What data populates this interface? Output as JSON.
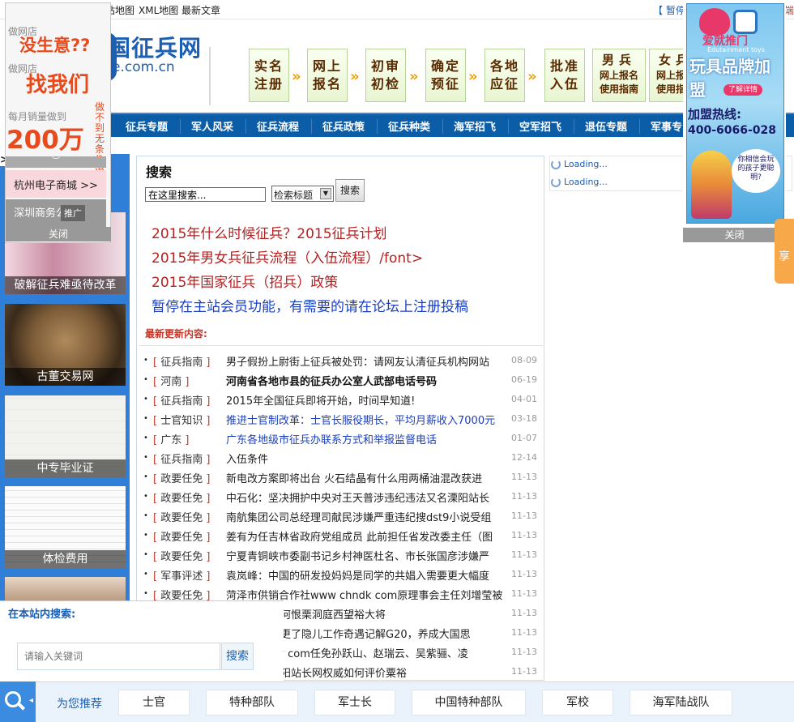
{
  "topbar": {
    "left_items": [
      "站地图",
      "XML地图",
      "最新文章"
    ],
    "right_text": "【  暂停",
    "right_tail": "端"
  },
  "header": {
    "logo_main": "国征兵网",
    "logo_sub": "e.com.cn"
  },
  "flow_steps": [
    {
      "label": "实名注册"
    },
    {
      "label": "网上报名"
    },
    {
      "label": "初审初检"
    },
    {
      "label": "确定预征"
    },
    {
      "label": "各地应征"
    },
    {
      "label": "批准入伍"
    }
  ],
  "guide_buttons": [
    {
      "big": "男兵",
      "line1": "网上报名",
      "line2": "使用指南"
    },
    {
      "big": "女兵",
      "line1": "网上报名",
      "line2": "使用指南"
    }
  ],
  "nav": {
    "items": [
      "征兵专题",
      "军人风采",
      "征兵流程",
      "征兵政策",
      "征兵种类",
      "海军招飞",
      "空军招飞",
      "退伍专题",
      "军事专"
    ]
  },
  "left_ad": {
    "line1": "做网店",
    "line2": "没生意??",
    "line3": "做网店",
    "line4": "找我们",
    "line5": "每月销量做到",
    "line6": "200万",
    "vertical": "做不到无条件退款",
    "slider_glyph": "︶",
    "link1": "杭州电子商城 >>",
    "link2": "深圳商务公司",
    "promo": "推广",
    "close": "关闭"
  },
  "left_arrows": ">>",
  "left_thumbs": [
    {
      "caption": "破解征兵难亟待改革"
    },
    {
      "caption": "古董交易网"
    },
    {
      "caption": "中专毕业证"
    },
    {
      "caption": "体检费用"
    }
  ],
  "search": {
    "title": "搜索",
    "input_value": "在这里搜索...",
    "select_value": "检索标题",
    "button": "搜索"
  },
  "headlines": [
    {
      "text": "2015年什么时候征兵？2015征兵计划",
      "color": "#b22222"
    },
    {
      "text": "2015年男女兵征兵流程（入伍流程）/font>",
      "color": "#b22222"
    },
    {
      "text": "2015年国家征兵（招兵）政策",
      "color": "#b22222"
    },
    {
      "text": "暂停在主站会员功能，有需要的请在论坛上注册投稿",
      "color": "#1a3fbf"
    }
  ],
  "latest": {
    "heading": "最新更新内容:",
    "rows": [
      {
        "cat": "征兵指南",
        "title": "男子假扮上尉街上征兵被处罚：请网友认清征兵机构网站",
        "date": "08-09",
        "style": "normal"
      },
      {
        "cat": "河南",
        "title": "河南省各地市县的征兵办公室人武部电话号码",
        "date": "06-19",
        "style": "bold"
      },
      {
        "cat": "征兵指南",
        "title": "2015年全国征兵即将开始，时间早知道!",
        "date": "04-01",
        "style": "normal"
      },
      {
        "cat": "士官知识",
        "title": "推进士官制改革：士官长服役期长，平均月薪收入7000元",
        "date": "03-18",
        "style": "blue"
      },
      {
        "cat": "广东",
        "title": "广东各地级市征兵办联系方式和举报监督电话",
        "date": "01-07",
        "style": "blue"
      },
      {
        "cat": "征兵指南",
        "title": "入伍条件",
        "date": "12-14",
        "style": "normal"
      },
      {
        "cat": "政要任免",
        "title": "新电改方案即将出台 火石结晶有什么用两桶油混改获进",
        "date": "11-13",
        "style": "normal"
      },
      {
        "cat": "政要任免",
        "title": "中石化：坚决拥护中央对王天普涉违纪违法又名溧阳站长",
        "date": "11-13",
        "style": "normal"
      },
      {
        "cat": "政要任免",
        "title": "南航集团公司总经理司献民涉嫌严重违纪搜dst9小说受组",
        "date": "11-13",
        "style": "normal"
      },
      {
        "cat": "政要任免",
        "title": "姜有为任吉林省政府党组成员 此前担任省发改委主任（图",
        "date": "11-13",
        "style": "normal"
      },
      {
        "cat": "政要任免",
        "title": "宁夏青铜峡市委副书记乡村神医杜名、市长张国彦涉嫌严",
        "date": "11-13",
        "style": "normal"
      },
      {
        "cat": "军事评述",
        "title": "袁岚峰：中国的研发投妈妈是同学的共娼入需要更大幅度",
        "date": "11-13",
        "style": "normal"
      },
      {
        "cat": "政要任免",
        "title": "菏泽市供销合作社www chndk com原理事会主任刘增莹被",
        "date": "11-13",
        "style": "normal"
      },
      {
        "cat": "",
        "title": "友为何恨栗洞庭西望裕大将",
        "date": "11-13",
        "style": "normal"
      },
      {
        "cat": "",
        "title": "人须更了隐儿工作奇遇记解G20，养成大国思",
        "date": "11-13",
        "style": "normal"
      },
      {
        "cat": "",
        "title": "busy com任免孙跃山、赵瑞云、吴紫骊、凌",
        "date": "11-13",
        "style": "normal"
      },
      {
        "cat": "",
        "title": "名溧阳站长网权威如何评价粟裕",
        "date": "11-13",
        "style": "normal"
      }
    ]
  },
  "loading": [
    "Loading...",
    "Loading..."
  ],
  "right_ad": {
    "brand": "爱就推门",
    "brand_en": "Edutainment toys",
    "headline": "玩具品牌加盟",
    "detail_btn": "了解详情",
    "hotline_label": "加盟热线:",
    "hotline": "400-6066-028",
    "bubble": "你相信会玩的孩子更聪明?",
    "close": "关闭"
  },
  "share": "享",
  "site_search": {
    "title": "在本站内搜索:",
    "placeholder": "请输入关键词",
    "button": "搜索"
  },
  "bottom": {
    "label": "为您推荐",
    "tags": [
      "士官",
      "特种部队",
      "军士长",
      "中国特种部队",
      "军校",
      "海军陆战队"
    ]
  }
}
